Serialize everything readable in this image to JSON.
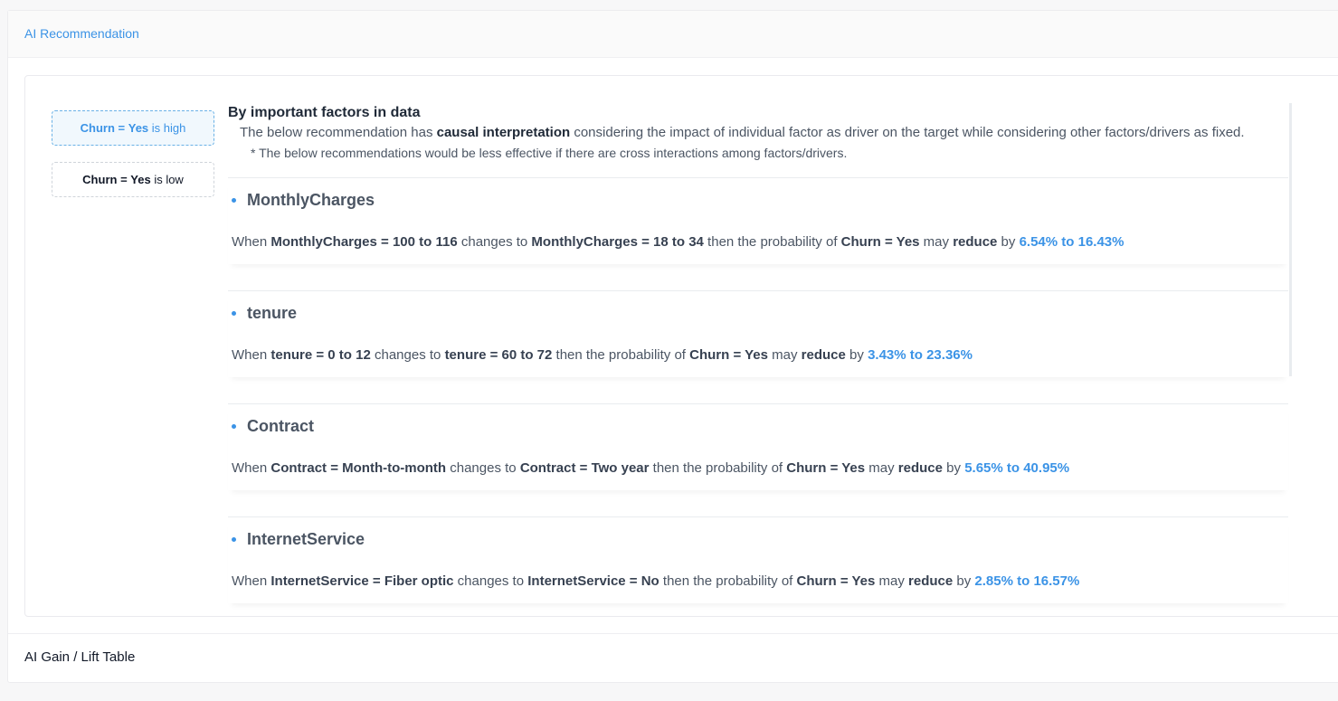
{
  "section": {
    "title": "AI Recommendation"
  },
  "toggles": [
    {
      "target": "Churn",
      "eq": " = ",
      "value": "Yes",
      "suffix": " is high",
      "active": true
    },
    {
      "target": "Churn",
      "eq": " = ",
      "value": "Yes",
      "suffix": " is low",
      "active": false
    }
  ],
  "intro": {
    "title": "By important factors in data",
    "desc_pre": "The below recommendation has ",
    "desc_bold": "causal interpretation",
    "desc_post": " considering the impact of individual factor as driver on the target while considering other factors/drivers as fixed.",
    "note": "* The below recommendations would be less effective if there are cross interactions among factors/drivers."
  },
  "factors": [
    {
      "name": "MonthlyCharges",
      "when": "When ",
      "from": "MonthlyCharges = 100 to 116",
      "changes": " changes to ",
      "to": "MonthlyCharges = 18 to 34",
      "then": " then the probability of ",
      "target": "Churn = Yes",
      "may": " may ",
      "action": "reduce",
      "by": " by ",
      "range": "6.54% to 16.43%"
    },
    {
      "name": "tenure",
      "when": "When ",
      "from": "tenure = 0 to 12",
      "changes": " changes to ",
      "to": "tenure = 60 to 72",
      "then": " then the probability of ",
      "target": "Churn = Yes",
      "may": " may ",
      "action": "reduce",
      "by": " by ",
      "range": "3.43% to 23.36%"
    },
    {
      "name": "Contract",
      "when": "When ",
      "from": "Contract = Month-to-month",
      "changes": " changes to ",
      "to": "Contract = Two year",
      "then": " then the probability of ",
      "target": "Churn = Yes",
      "may": " may ",
      "action": "reduce",
      "by": " by ",
      "range": "5.65% to 40.95%"
    },
    {
      "name": "InternetService",
      "when": "When ",
      "from": "InternetService = Fiber optic",
      "changes": " changes to ",
      "to": "InternetService = No",
      "then": " then the probability of ",
      "target": "Churn = Yes",
      "may": " may ",
      "action": "reduce",
      "by": " by ",
      "range": "2.85% to 16.57%"
    }
  ],
  "gain": {
    "title": "AI Gain / Lift Table"
  },
  "colors": {
    "accent": "#3b93e6",
    "text": "#4b5563",
    "heading": "#1f2937"
  }
}
